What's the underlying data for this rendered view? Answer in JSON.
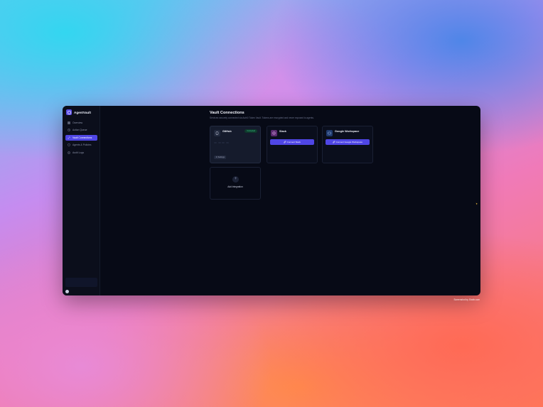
{
  "app": {
    "name": "AgentVault"
  },
  "sidebar": {
    "items": [
      {
        "label": "Overview",
        "icon": "grid-icon",
        "active": false
      },
      {
        "label": "Action Queue",
        "icon": "clock-icon",
        "active": false
      },
      {
        "label": "Vault Connections",
        "icon": "link-icon",
        "active": true
      },
      {
        "label": "Agents & Policies",
        "icon": "shield-icon",
        "active": false
      },
      {
        "label": "Audit Logs",
        "icon": "document-icon",
        "active": false
      }
    ],
    "footer": {
      "line1": "",
      "line2": ""
    },
    "user": {
      "meta": ""
    }
  },
  "page": {
    "title": "Vault Connections",
    "subtitle": "Services securely connected via Auth0 Token Vault. Tokens are encrypted and never exposed to agents."
  },
  "cards": [
    {
      "name": "GitHub",
      "description": "",
      "status": "Connected",
      "scope_label": "",
      "scopes": [
        "",
        "",
        "",
        ""
      ],
      "connected_label": "",
      "button": "Settings",
      "icon": "github-icon",
      "icon_bg": "#222a3e"
    },
    {
      "name": "Slack",
      "description": "",
      "button": "Connect Slack",
      "icon": "slack-icon",
      "icon_bg": "#5a2a6e"
    },
    {
      "name": "Google Workspace",
      "description": "",
      "button": "Connect Google Workspace",
      "icon": "google-icon",
      "icon_bg": "#1f3a6e"
    }
  ],
  "add_integration": {
    "title": "Add Integration",
    "subtitle": ""
  },
  "credit": "Screenshot by Shottr.com",
  "colors": {
    "accent": "#4f46e5",
    "success": "#3ddc97",
    "window_bg": "#070a16"
  }
}
